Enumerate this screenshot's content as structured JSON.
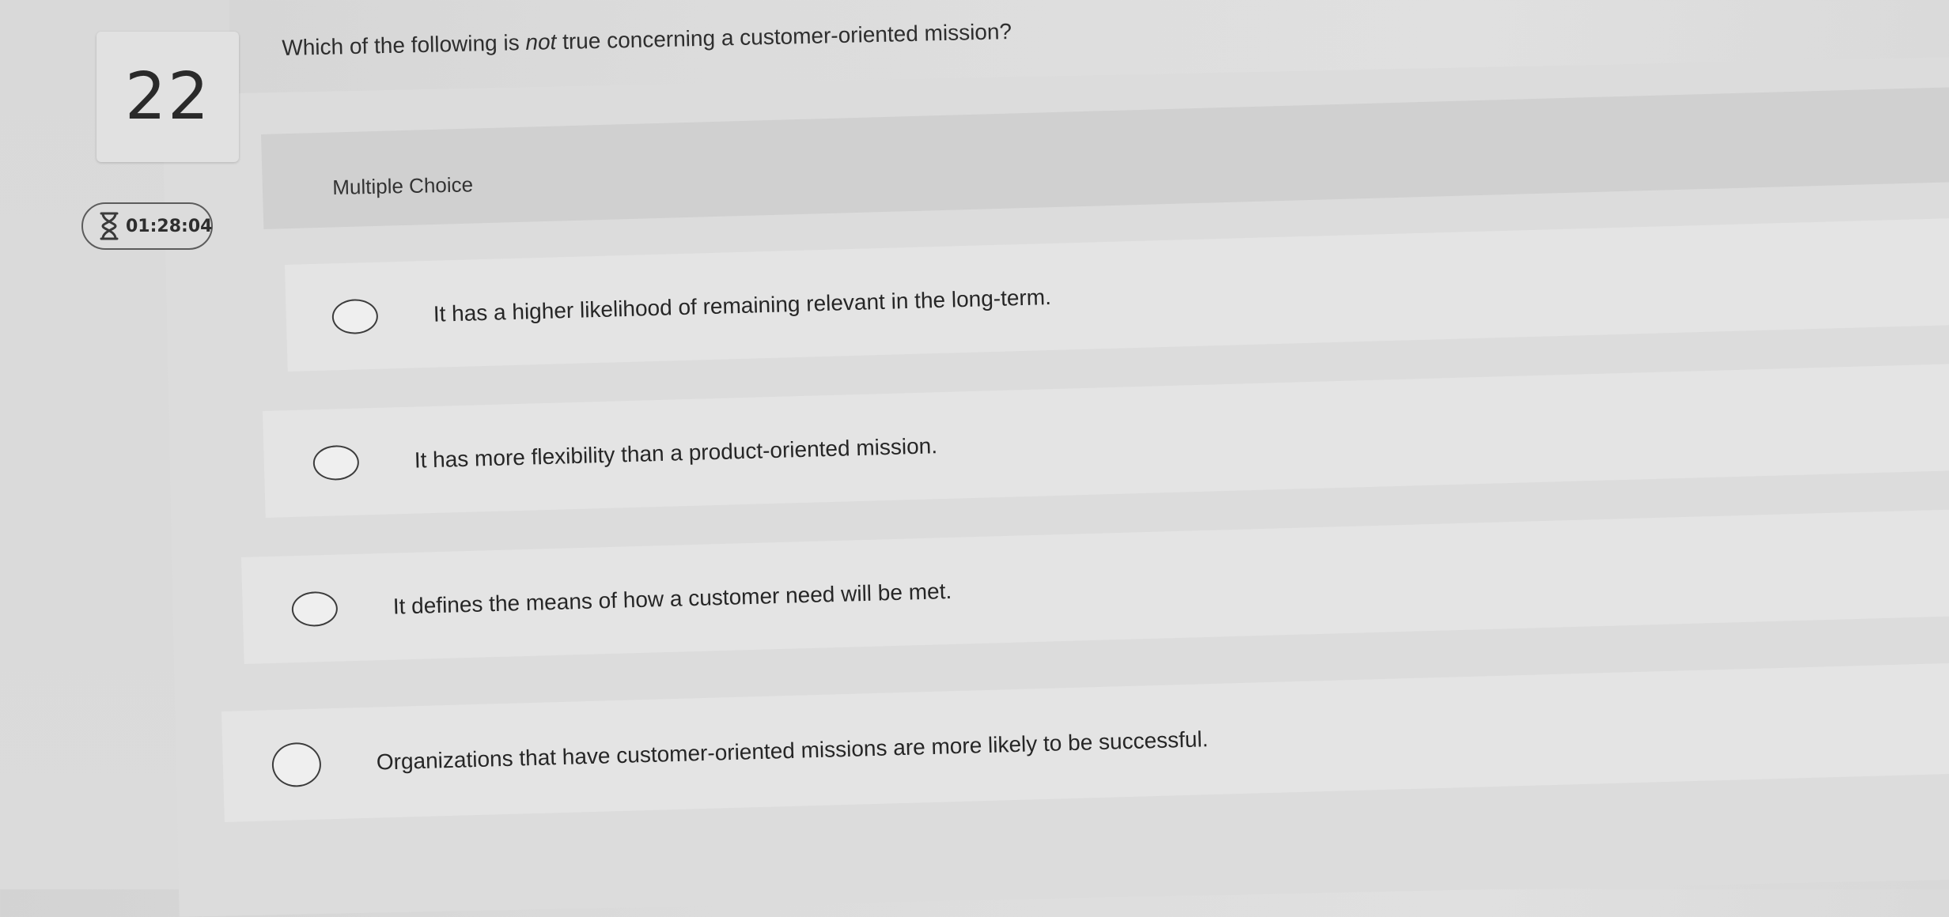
{
  "question": {
    "number": "22",
    "text_before": "Which of the following is ",
    "text_emphasis": "not",
    "text_after": " true concerning a customer-oriented mission?"
  },
  "timer": {
    "icon": "hourglass-icon",
    "value": "01:28:04"
  },
  "answer_area": {
    "type_label": "Multiple Choice",
    "options": [
      {
        "label": "It has a higher likelihood of remaining relevant in the long-term.",
        "selected": false
      },
      {
        "label": "It has more flexibility than a product-oriented mission.",
        "selected": false
      },
      {
        "label": "It defines the means of how a customer need will be met.",
        "selected": false
      },
      {
        "label": "Organizations that have customer-oriented missions are more likely to be successful.",
        "selected": false
      }
    ]
  }
}
